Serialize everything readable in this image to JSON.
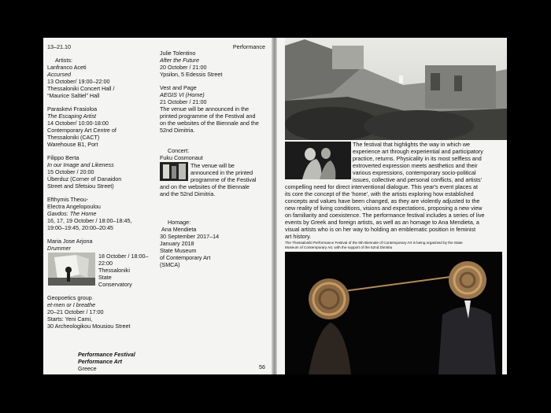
{
  "header": {
    "dates": "13–21.10",
    "section": "Performance"
  },
  "artists_label": "Artists:",
  "entries": {
    "aceti": {
      "name": "Lanfranco Aceti",
      "title": "Accursed",
      "line1": "13 October/ 19:00–22:00",
      "line2": "Thessaloniki Concert Hall /",
      "line3": "“Maurice Saltiel” Hall"
    },
    "frasioloa": {
      "name": "Paraskevi Frasioloa",
      "title": "The Escaping Artist",
      "line1": "14 October/ 10:00-18:00",
      "line2": "Contemporary Art Centre of",
      "line3": "Thessaloniki (CACT)",
      "line4": "Warehouse B1, Port"
    },
    "berta": {
      "name": "Filippo Berta",
      "title": "In our Image and Likeness",
      "line1": "15 October / 20:00",
      "line2": "Überduz (Corner of Danaidon",
      "line3": "Street and Sfetsiou Street)"
    },
    "theou": {
      "name": "Efthymis Theou-",
      "name2": "Electra Angelopoulou",
      "title": "Gavdos: The Home",
      "line1": "16, 17, 19 October / 18:00–18:45,",
      "line2": "19:00–19:45, 20:00–20:45"
    },
    "arjona": {
      "name": "Maria Jose Arjona",
      "title": "Drummer",
      "line1": "18 October / 18:00–",
      "line2": "22:00",
      "line3": "Thessaloniki",
      "line4": "State",
      "line5": "Conservatory"
    },
    "geopoetics": {
      "name": "Geopoetics group",
      "title": "et-men or I breathe",
      "line1": "20–21 October / 17:00",
      "line2": "Starts: Yeni Cami,",
      "line3": "30 Archeologikou Mousiou Street"
    },
    "tolentino": {
      "name": "Julie Tolentino",
      "title": "After the Future",
      "line1": "20 October / 21:00",
      "line2": "Ypsilon, 5 Edessis Street"
    },
    "vest": {
      "name": "Vest and Page",
      "title": "AEGIS VI (Home)",
      "line1": "21 October / 21:00",
      "line2": "The venue will be announced in the",
      "line3": "printed programme of the Festival and",
      "line4": "on the websites of the Biennale and the",
      "line5": "52nd Dimitria."
    }
  },
  "concert": {
    "label": "Concert:",
    "name": "Fuku Cosmonaut",
    "l1": "The venue will be",
    "l2": "announced in the printed",
    "l3": "programme of the Festival",
    "l4": "and on the websites of the Biennale",
    "l5": "and the 52nd Dimitria."
  },
  "homage": {
    "label": "Homage:",
    "name": "Ana Mendieta",
    "line1": "30 September 2017–14",
    "line2": "January 2018",
    "line3": "State Museum",
    "line4": "of Contemporary Art",
    "line5": "(SMCA)"
  },
  "footer": {
    "title1": "Performance Festival",
    "title2": "Performance Art",
    "place": "Greece",
    "page": "56"
  },
  "right": {
    "para": [
      "The festival that highlights the way in which we",
      "experience art through experiential and participatory",
      "practice, returns. Physicality in its most selfless and",
      "extroverted expression meets aesthetics and their",
      "various expressions, contemporary socio-political",
      "issues, collective and personal conflicts, and artists'",
      "compelling need for direct interventional dialogue. This year's event places at",
      "its core the concept of the 'home', with the artists exploring how established",
      "concepts and values have been changed, as they are violently adjusted to the",
      "new reality of living conditions, visions and expectations, proposing a new view",
      "on familiarity and coexistence. The performance festival includes a series of live",
      "events by Greek and foreign artists, as well as an homage to Ana Mendieta, a",
      "visual artists who is on her way to holding an emblematic position in feminist",
      "art history."
    ],
    "caption1": "The Thessaloniki Performance Festival of the 6th Biennale of Contemporary Art is being organized by the State",
    "caption2": "Museum of Contemporary Art, with the support of the 52nd Dimitria"
  }
}
